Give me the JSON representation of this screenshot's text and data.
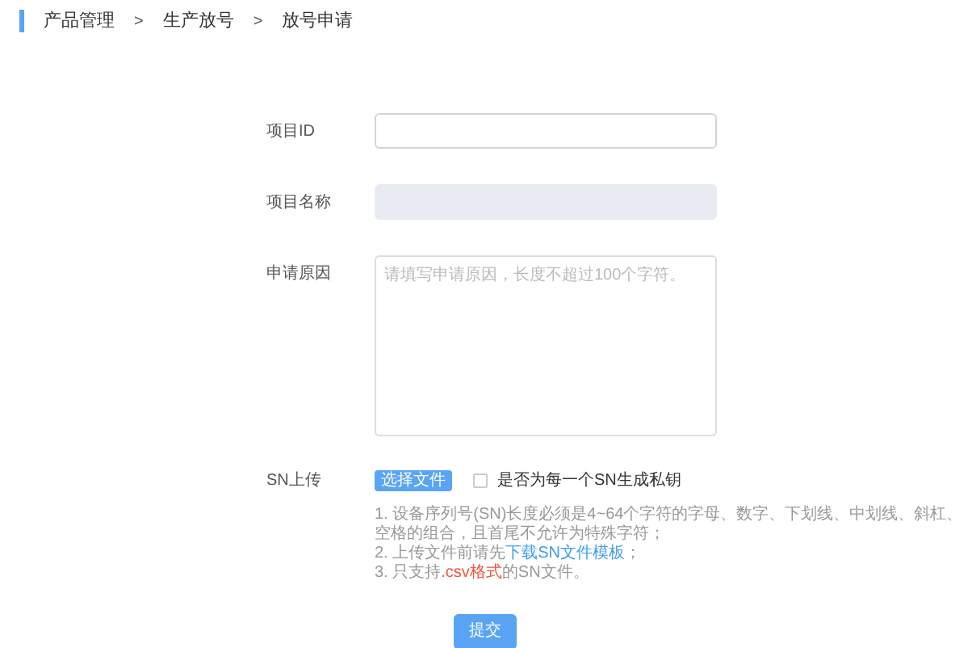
{
  "breadcrumb": [
    "产品管理",
    "生产放号",
    "放号申请"
  ],
  "breadcrumb_separator": ">",
  "fields": [
    {
      "kind": "input",
      "label": "项目ID",
      "disabled": false
    },
    {
      "kind": "input",
      "label": "项目名称",
      "disabled": true
    },
    {
      "kind": "textarea",
      "label": "申请原因",
      "placeholder": "请填写申请原因，长度不超过100个字符。"
    }
  ],
  "upload": {
    "label": "SN上传",
    "button": "选择文件",
    "checkbox": {
      "label": "是否为每一个SN生成私钥",
      "checked": false
    }
  },
  "notes": [
    {
      "number": "1.",
      "parts": [
        {
          "kind": "plain",
          "text": "设备序列号(SN)长度必须是4~64个字符的字母、数字、下划线、中划线、斜杠、空格的组合，且首尾不允许为特殊字符；"
        }
      ]
    },
    {
      "number": "2.",
      "parts": [
        {
          "kind": "plain",
          "text": "上传文件前请先"
        },
        {
          "kind": "link",
          "text": "下载SN文件模板"
        },
        {
          "kind": "plain",
          "text": "；"
        }
      ]
    },
    {
      "number": "3.",
      "parts": [
        {
          "kind": "plain",
          "text": "只支持"
        },
        {
          "kind": "highlight",
          "text": ".csv格式"
        },
        {
          "kind": "plain",
          "text": "的SN文件。"
        }
      ]
    }
  ],
  "submit": "提交"
}
